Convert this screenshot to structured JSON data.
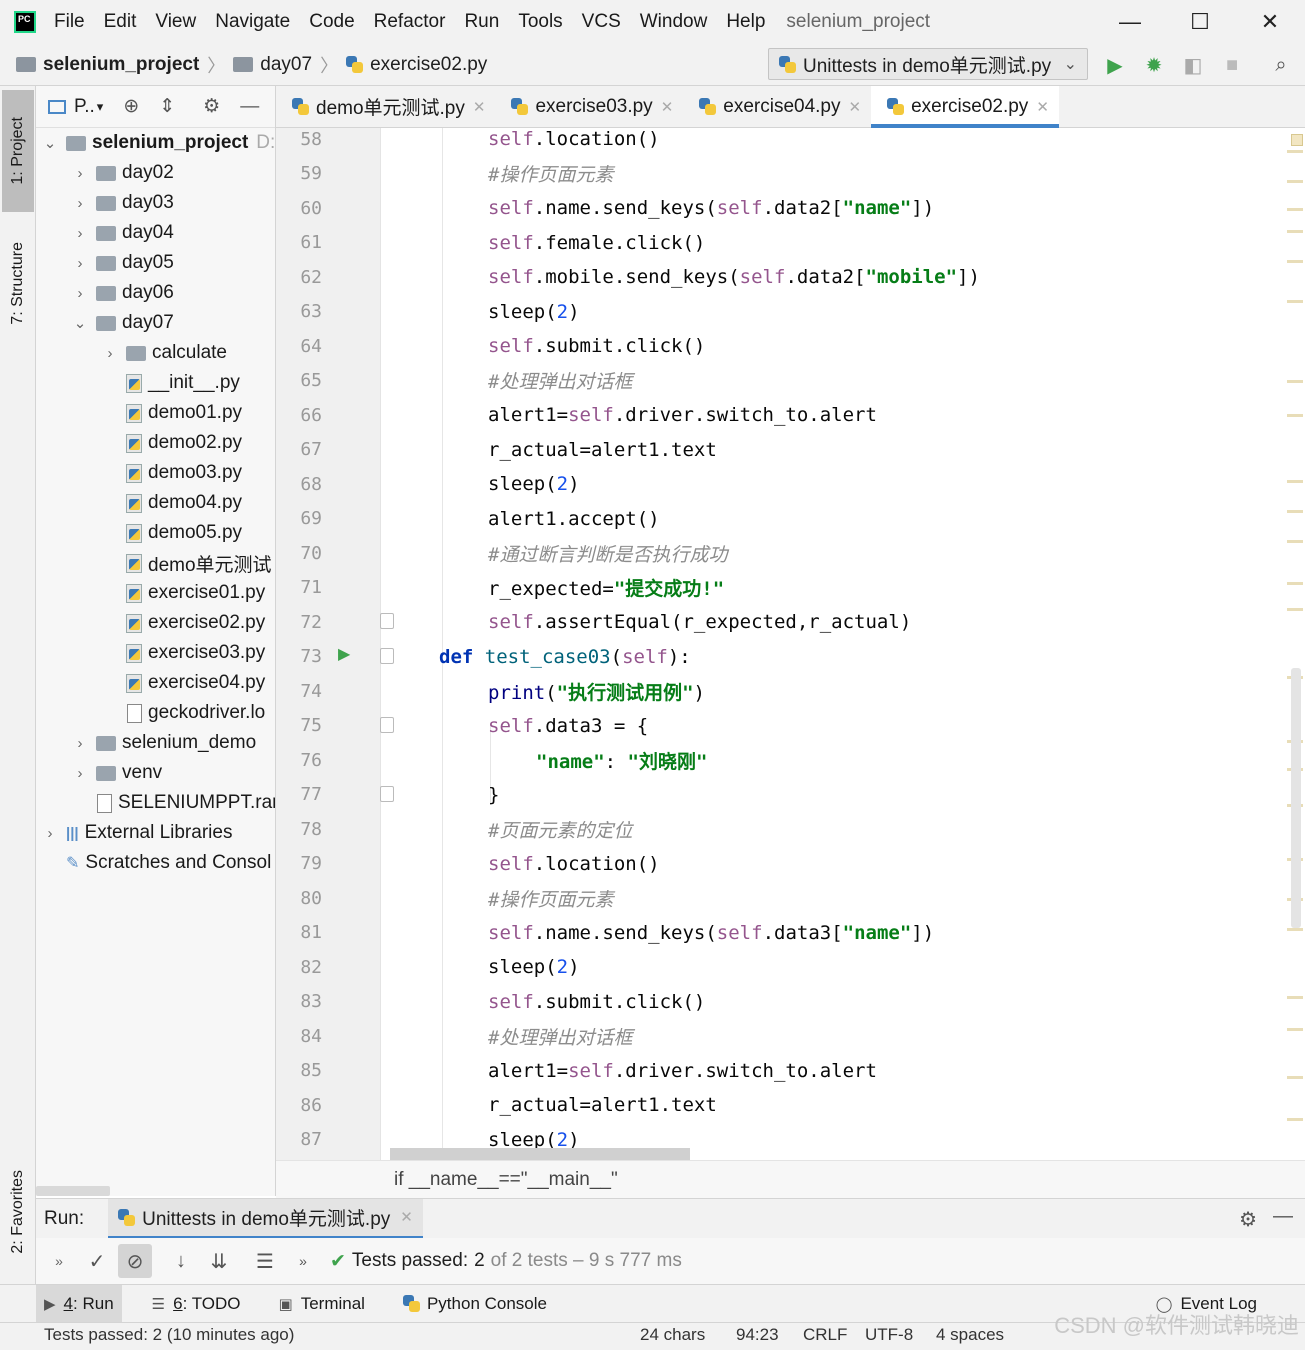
{
  "menubar": {
    "logo": "PC",
    "items": [
      "File",
      "Edit",
      "View",
      "Navigate",
      "Code",
      "Refactor",
      "Run",
      "Tools",
      "VCS",
      "Window",
      "Help"
    ],
    "window_title": "selenium_project",
    "controls": {
      "minimize": "—",
      "maximize": "☐",
      "close": "✕"
    }
  },
  "navbar": {
    "breadcrumb": [
      "selenium_project",
      "day07",
      "exercise02.py"
    ],
    "run_config": "Unittests in demo单元测试.py"
  },
  "left_strip": {
    "tabs": [
      "1: Project",
      "7: Structure",
      "2: Favorites"
    ]
  },
  "project_panel": {
    "title": "P..",
    "tree": [
      {
        "label": "selenium_project",
        "suffix": "D:",
        "kind": "root",
        "expanded": true
      },
      {
        "label": "day02",
        "kind": "folder"
      },
      {
        "label": "day03",
        "kind": "folder"
      },
      {
        "label": "day04",
        "kind": "folder"
      },
      {
        "label": "day05",
        "kind": "folder"
      },
      {
        "label": "day06",
        "kind": "folder"
      },
      {
        "label": "day07",
        "kind": "folder",
        "expanded": true
      },
      {
        "label": "calculate",
        "kind": "folder"
      },
      {
        "label": "__init__.py",
        "kind": "py"
      },
      {
        "label": "demo01.py",
        "kind": "py"
      },
      {
        "label": "demo02.py",
        "kind": "py"
      },
      {
        "label": "demo03.py",
        "kind": "py"
      },
      {
        "label": "demo04.py",
        "kind": "py"
      },
      {
        "label": "demo05.py",
        "kind": "py"
      },
      {
        "label": "demo单元测试",
        "kind": "py"
      },
      {
        "label": "exercise01.py",
        "kind": "py"
      },
      {
        "label": "exercise02.py",
        "kind": "py"
      },
      {
        "label": "exercise03.py",
        "kind": "py"
      },
      {
        "label": "exercise04.py",
        "kind": "py"
      },
      {
        "label": "geckodriver.lo",
        "kind": "plain"
      },
      {
        "label": "selenium_demo",
        "kind": "folder"
      },
      {
        "label": "venv",
        "kind": "folder"
      },
      {
        "label": "SELENIUMPPT.rar",
        "kind": "plain"
      },
      {
        "label": "External Libraries",
        "kind": "lib"
      },
      {
        "label": "Scratches and Consol",
        "kind": "scratch"
      }
    ]
  },
  "editor_tabs": [
    {
      "label": "demo单元测试.py",
      "active": false
    },
    {
      "label": "exercise03.py",
      "active": false
    },
    {
      "label": "exercise04.py",
      "active": false
    },
    {
      "label": "exercise02.py",
      "active": true
    }
  ],
  "editor": {
    "lines": [
      {
        "n": "58",
        "code": "self.location()"
      },
      {
        "n": "59",
        "code": "#操作页面元素"
      },
      {
        "n": "60",
        "code": "self.name.send_keys(self.data2[\"name\"])"
      },
      {
        "n": "61",
        "code": "self.female.click()"
      },
      {
        "n": "62",
        "code": "self.mobile.send_keys(self.data2[\"mobile\"])"
      },
      {
        "n": "63",
        "code": "sleep(2)"
      },
      {
        "n": "64",
        "code": "self.submit.click()"
      },
      {
        "n": "65",
        "code": "#处理弹出对话框"
      },
      {
        "n": "66",
        "code": "alert1=self.driver.switch_to.alert"
      },
      {
        "n": "67",
        "code": "r_actual=alert1.text"
      },
      {
        "n": "68",
        "code": "sleep(2)"
      },
      {
        "n": "69",
        "code": "alert1.accept()"
      },
      {
        "n": "70",
        "code": "#通过断言判断是否执行成功"
      },
      {
        "n": "71",
        "code": "r_expected=\"提交成功!\""
      },
      {
        "n": "72",
        "code": "self.assertEqual(r_expected,r_actual)"
      },
      {
        "n": "73",
        "code": "def test_case03(self):"
      },
      {
        "n": "74",
        "code": "print(\"执行测试用例\")"
      },
      {
        "n": "75",
        "code": "self.data3 = {"
      },
      {
        "n": "76",
        "code": "\"name\": \"刘晓刚\""
      },
      {
        "n": "77",
        "code": "}"
      },
      {
        "n": "78",
        "code": "#页面元素的定位"
      },
      {
        "n": "79",
        "code": "self.location()"
      },
      {
        "n": "80",
        "code": "#操作页面元素"
      },
      {
        "n": "81",
        "code": "self.name.send_keys(self.data3[\"name\"])"
      },
      {
        "n": "82",
        "code": "sleep(2)"
      },
      {
        "n": "83",
        "code": "self.submit.click()"
      },
      {
        "n": "84",
        "code": "#处理弹出对话框"
      },
      {
        "n": "85",
        "code": "alert1=self.driver.switch_to.alert"
      },
      {
        "n": "86",
        "code": "r_actual=alert1.text"
      },
      {
        "n": "87",
        "code": "sleep(2)"
      }
    ],
    "breadcrumb": "if __name__==\"__main__\""
  },
  "run_panel": {
    "label": "Run:",
    "tab": "Unittests in demo单元测试.py",
    "status_prefix": "Tests passed:",
    "status_count": "2",
    "status_rest": "of 2 tests – 9 s 777 ms"
  },
  "bottom_bar": {
    "items": [
      {
        "num": "4",
        "label": ": Run"
      },
      {
        "num": "6",
        "label": ": TODO"
      },
      {
        "num": "",
        "label": "Terminal"
      },
      {
        "num": "",
        "label": "Python Console"
      }
    ],
    "event_log": "Event Log"
  },
  "statusbar": {
    "message": "Tests passed: 2 (10 minutes ago)",
    "chars": "24 chars",
    "position": "94:23",
    "line_sep": "CRLF",
    "encoding": "UTF-8",
    "indent": "4 spaces"
  },
  "watermark": "CSDN @软件测试韩晓迪"
}
